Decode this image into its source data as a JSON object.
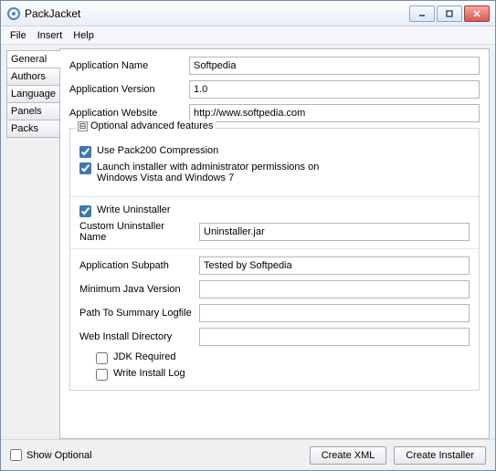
{
  "window": {
    "title": "PackJacket"
  },
  "menu": {
    "file": "File",
    "insert": "Insert",
    "help": "Help"
  },
  "tabs": {
    "general": "General",
    "authors": "Authors",
    "language": "Language",
    "panels": "Panels",
    "packs": "Packs"
  },
  "fields": {
    "app_name_label": "Application Name",
    "app_name_value": "Softpedia",
    "app_version_label": "Application Version",
    "app_version_value": "1.0",
    "app_website_label": "Application Website",
    "app_website_value": "http://www.softpedia.com"
  },
  "advanced": {
    "header": "Optional advanced features",
    "expander": "⊟",
    "use_pack200": "Use Pack200 Compression",
    "launch_admin": "Launch installer with administrator permissions on Windows Vista and Windows 7",
    "write_uninstaller": "Write Uninstaller",
    "custom_uninstaller_label": "Custom Uninstaller Name",
    "custom_uninstaller_value": "Uninstaller.jar",
    "app_subpath_label": "Application Subpath",
    "app_subpath_value": "Tested by Softpedia",
    "min_java_label": "Minimum Java Version",
    "min_java_value": "",
    "summary_log_label": "Path To Summary Logfile",
    "summary_log_value": "",
    "web_install_label": "Web Install Directory",
    "web_install_value": "",
    "jdk_required": "JDK Required",
    "write_install_log": "Write Install Log"
  },
  "footer": {
    "show_optional": "Show Optional",
    "create_xml": "Create XML",
    "create_installer": "Create Installer"
  }
}
